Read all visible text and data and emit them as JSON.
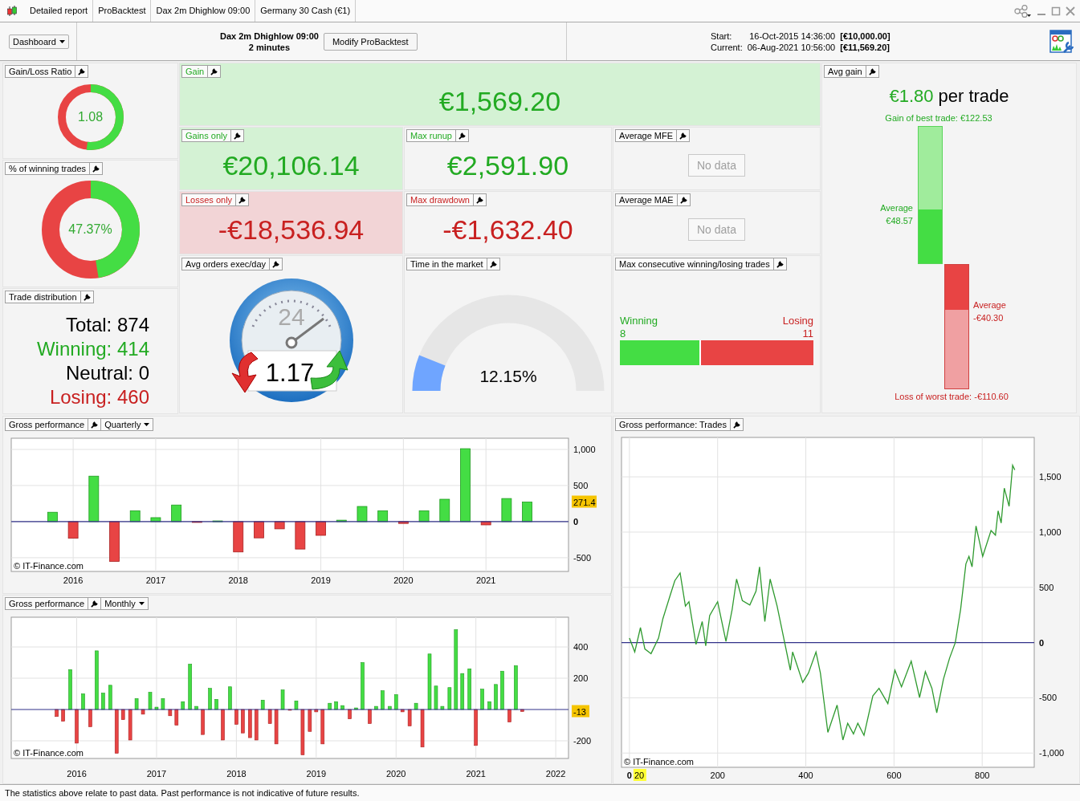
{
  "window": {
    "tabs": [
      "Detailed report",
      "ProBacktest",
      "Dax 2m Dhighlow 09:00",
      "Germany 30 Cash (€1)"
    ]
  },
  "toolbar": {
    "view_menu": "Dashboard",
    "strategy_name": "Dax 2m Dhighlow 09:00",
    "timeframe": "2 minutes",
    "modify_button": "Modify ProBacktest",
    "start_label": "Start:",
    "start_date": "16-Oct-2015 14:36:00",
    "start_capital": "[€10,000.00]",
    "current_label": "Current:",
    "current_date": "06-Aug-2021 10:56:00",
    "current_capital": "[€11,569.20]"
  },
  "gain_loss_ratio": {
    "title": "Gain/Loss Ratio",
    "value": "1.08",
    "level": 0.52
  },
  "winning_trades": {
    "title": "% of winning trades",
    "value": "47.37%",
    "level": 0.4737
  },
  "trade_distribution": {
    "title": "Trade distribution",
    "lines": [
      {
        "kind": "total",
        "text": "Total: 874"
      },
      {
        "kind": "winning",
        "text": "Winning: 414"
      },
      {
        "kind": "neutral",
        "text": "Neutral: 0"
      },
      {
        "kind": "losing",
        "text": "Losing: 460"
      }
    ]
  },
  "gain": {
    "title": "Gain",
    "value": "€1,569.20"
  },
  "stats": [
    {
      "kind": "gain",
      "title": "Gains only",
      "value": "€20,106.14"
    },
    {
      "kind": "runup",
      "title": "Max runup",
      "value": "€2,591.90"
    },
    {
      "kind": "nodata",
      "title": "Average MFE",
      "value": "No data"
    },
    {
      "kind": "loss",
      "title": "Losses only",
      "value": "-€18,536.94"
    },
    {
      "kind": "drawdown",
      "title": "Max drawdown",
      "value": "-€1,632.40"
    },
    {
      "kind": "nodata",
      "title": "Average MAE",
      "value": "No data"
    }
  ],
  "avg_orders": {
    "title": "Avg orders exec/day",
    "dial_value": "24",
    "value": "1.17"
  },
  "time_in_market": {
    "title": "Time in the market",
    "value": "12.15%",
    "level": 0.1215
  },
  "max_consecutive": {
    "title": "Max consecutive winning/losing trades",
    "winning_label": "Winning",
    "winning_count": "8",
    "losing_label": "Losing",
    "losing_count": "11",
    "level": 0.421
  },
  "avg_gain": {
    "title": "Avg gain",
    "amount": "€1.80",
    "suffix": "per trade",
    "best_label": "Gain of best trade: €122.53",
    "win_bar": {
      "label": "Average",
      "value": "€48.57",
      "level": 0.396
    },
    "loss_bar": {
      "label": "Average",
      "value": "-€40.30",
      "level": 0.364
    },
    "worst_label": "Loss of worst trade: -€110.60"
  },
  "quarterly": {
    "title": "Gross performance",
    "period": "Quarterly",
    "copyright": "© IT-Finance.com",
    "chart_data": {
      "type": "bar",
      "xlim": [
        2015.25,
        2022.0
      ],
      "ylim": [
        -690,
        1155
      ],
      "x": [
        2015.75,
        2016.0,
        2016.25,
        2016.5,
        2016.75,
        2017.0,
        2017.25,
        2017.5,
        2017.75,
        2018.0,
        2018.25,
        2018.5,
        2018.75,
        2019.0,
        2019.25,
        2019.5,
        2019.75,
        2020.0,
        2020.25,
        2020.5,
        2020.75,
        2021.0,
        2021.25,
        2021.5
      ],
      "series": [
        {
          "values": [
            130,
            -230,
            630,
            -550,
            150,
            55,
            230,
            -5,
            10,
            -420,
            -225,
            -100,
            -380,
            -190,
            20,
            210,
            150,
            -25,
            150,
            310,
            1010,
            -45,
            320,
            271.4
          ]
        }
      ],
      "xticks": [
        {
          "value": 2016,
          "label": "2016"
        },
        {
          "value": 2017,
          "label": "2017"
        },
        {
          "value": 2018,
          "label": "2018"
        },
        {
          "value": 2019,
          "label": "2019"
        },
        {
          "value": 2020,
          "label": "2020"
        },
        {
          "value": 2021,
          "label": "2021"
        }
      ],
      "yticks": [
        -500,
        0,
        500,
        {
          "value": 1000,
          "label": "1,000"
        }
      ],
      "grid": true,
      "ref_lines": [
        {
          "axis": "y",
          "value": 0,
          "color": "#33338a"
        }
      ],
      "annotations": [
        {
          "text": "271.4"
        }
      ]
    }
  },
  "monthly": {
    "title": "Gross performance",
    "period": "Monthly",
    "copyright": "© IT-Finance.com",
    "chart_data": {
      "type": "bar",
      "xlim": [
        2015.18,
        2022.16
      ],
      "ylim": [
        -313,
        590
      ],
      "x": [
        2015.75,
        2015.83,
        2015.92,
        2016.0,
        2016.08,
        2016.17,
        2016.25,
        2016.33,
        2016.42,
        2016.5,
        2016.58,
        2016.67,
        2016.75,
        2016.83,
        2016.92,
        2017.0,
        2017.08,
        2017.17,
        2017.25,
        2017.33,
        2017.42,
        2017.5,
        2017.58,
        2017.67,
        2017.75,
        2017.83,
        2017.92,
        2018.0,
        2018.08,
        2018.17,
        2018.25,
        2018.33,
        2018.42,
        2018.5,
        2018.58,
        2018.67,
        2018.75,
        2018.83,
        2018.92,
        2019.0,
        2019.08,
        2019.17,
        2019.25,
        2019.33,
        2019.42,
        2019.5,
        2019.58,
        2019.67,
        2019.75,
        2019.83,
        2019.92,
        2020.0,
        2020.08,
        2020.17,
        2020.25,
        2020.33,
        2020.42,
        2020.5,
        2020.58,
        2020.67,
        2020.75,
        2020.83,
        2020.92,
        2021.0,
        2021.08,
        2021.17,
        2021.25,
        2021.33,
        2021.42,
        2021.5,
        2021.58
      ],
      "series": [
        {
          "values": [
            -45,
            -75,
            255,
            -215,
            100,
            -110,
            375,
            105,
            155,
            -280,
            -65,
            -195,
            70,
            -30,
            110,
            15,
            70,
            -40,
            -100,
            50,
            290,
            20,
            -160,
            135,
            65,
            -195,
            145,
            -95,
            -150,
            -180,
            -195,
            60,
            -90,
            -220,
            125,
            -5,
            55,
            -290,
            -140,
            -15,
            -220,
            40,
            50,
            25,
            -60,
            10,
            300,
            -90,
            20,
            120,
            20,
            95,
            -15,
            -105,
            40,
            -240,
            355,
            150,
            20,
            140,
            510,
            230,
            260,
            -230,
            130,
            50,
            160,
            245,
            -80,
            280,
            -13
          ]
        }
      ],
      "xticks": [
        {
          "value": 2016,
          "label": "2016"
        },
        {
          "value": 2017,
          "label": "2017"
        },
        {
          "value": 2018,
          "label": "2018"
        },
        {
          "value": 2019,
          "label": "2019"
        },
        {
          "value": 2020,
          "label": "2020"
        },
        {
          "value": 2021,
          "label": "2021"
        },
        {
          "value": 2022,
          "label": "2022"
        }
      ],
      "yticks": [
        -200,
        200,
        400
      ],
      "grid": true,
      "ref_lines": [
        {
          "axis": "y",
          "value": 0,
          "color": "#33338a"
        }
      ],
      "annotations": [
        {
          "text": "-13"
        }
      ]
    }
  },
  "trades": {
    "title": "Gross performance: Trades",
    "copyright": "© IT-Finance.com",
    "chart_data": {
      "type": "line",
      "xlim": [
        -18,
        918
      ],
      "ylim": [
        -1129,
        1857
      ],
      "x": [
        0,
        12,
        25,
        35,
        49,
        66,
        76,
        93,
        103,
        115,
        127,
        135,
        151,
        165,
        173,
        182,
        200,
        219,
        233,
        243,
        256,
        273,
        287,
        295,
        307,
        319,
        335,
        352,
        365,
        370,
        393,
        406,
        423,
        433,
        450,
        471,
        484,
        495,
        508,
        518,
        532,
        552,
        566,
        586,
        602,
        617,
        639,
        658,
        671,
        686,
        697,
        712,
        726,
        739,
        751,
        763,
        770,
        777,
        786,
        801,
        820,
        830,
        836,
        843,
        850,
        861,
        869,
        874
      ],
      "series": [
        {
          "color": "#2f9a2f",
          "values": [
            40,
            -85,
            135,
            -58,
            -100,
            40,
            217,
            437,
            560,
            630,
            330,
            370,
            -16,
            190,
            -30,
            245,
            370,
            10,
            300,
            575,
            380,
            340,
            465,
            685,
            190,
            575,
            330,
            0,
            -250,
            -85,
            -360,
            -277,
            -85,
            -277,
            -813,
            -566,
            -882,
            -730,
            -827,
            -730,
            -840,
            -483,
            -415,
            -552,
            -250,
            -400,
            -168,
            -497,
            -263,
            -415,
            -635,
            -332,
            -140,
            0,
            300,
            712,
            780,
            685,
            1055,
            780,
            1014,
            973,
            1192,
            1082,
            1398,
            1234,
            1604,
            1563
          ]
        }
      ],
      "xticks": [
        0,
        200,
        400,
        600,
        800
      ],
      "yticks": [
        {
          "value": -1000,
          "label": "-1,000"
        },
        -500,
        0,
        500,
        {
          "value": 1000,
          "label": "1,000"
        },
        {
          "value": 1500,
          "label": "1,500"
        }
      ],
      "grid": true,
      "ref_lines": [
        {
          "axis": "y",
          "value": 0,
          "color": "#33338a"
        }
      ],
      "annotations": [
        {
          "text": "20"
        }
      ]
    }
  },
  "footer": "The statistics above relate to past data. Past performance is not indicative of future results."
}
